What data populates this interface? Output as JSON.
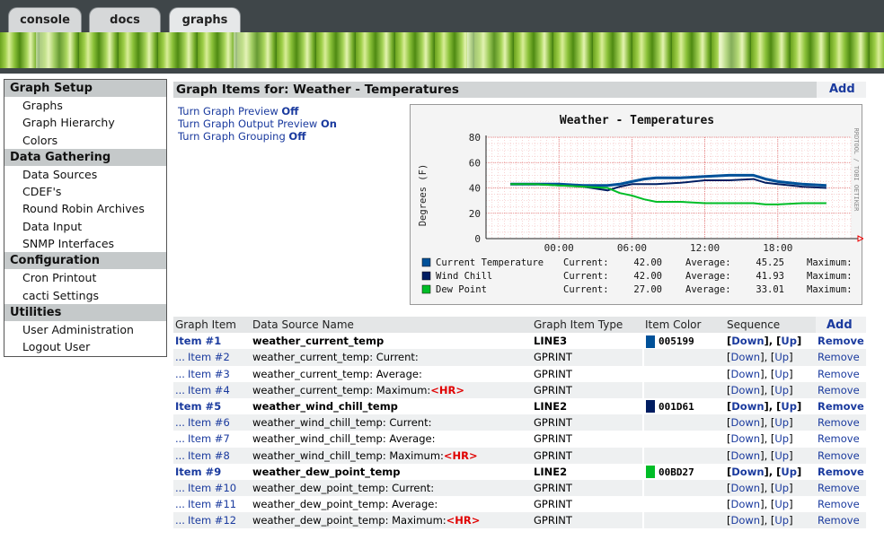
{
  "tabs": [
    "console",
    "docs",
    "graphs"
  ],
  "menu": {
    "sections": [
      {
        "title": "Graph Setup",
        "items": [
          "Graphs",
          "Graph Hierarchy",
          "Colors"
        ]
      },
      {
        "title": "Data Gathering",
        "items": [
          "Data Sources",
          "CDEF's",
          "Round Robin Archives",
          "Data Input",
          "SNMP Interfaces"
        ]
      },
      {
        "title": "Configuration",
        "items": [
          "Cron Printout",
          "cacti Settings"
        ]
      },
      {
        "title": "Utilities",
        "items": [
          "User Administration",
          "Logout User"
        ]
      }
    ]
  },
  "main": {
    "title": "Graph Items for: Weather - Temperatures",
    "add_label": "Add",
    "toggles": [
      {
        "label": "Turn Graph Preview",
        "state": "Off"
      },
      {
        "label": "Turn Graph Output Preview",
        "state": "On"
      },
      {
        "label": "Turn Graph Grouping",
        "state": "Off"
      }
    ]
  },
  "graph": {
    "side_text": "RRDTOOL / TOBI OETIKER",
    "legend": [
      {
        "name": "Current Temperature",
        "color": "#005199",
        "current": "42.00",
        "average": "45.25"
      },
      {
        "name": "Wind Chill",
        "color": "#001D61",
        "current": "42.00",
        "average": "41.93"
      },
      {
        "name": "Dew Point",
        "color": "#00BD27",
        "current": "27.00",
        "average": "33.01"
      }
    ],
    "legend_labels": {
      "current": "Current:",
      "average": "Average:",
      "maximum": "Maximum:"
    }
  },
  "chart_data": {
    "type": "line",
    "title": "Weather - Temperatures",
    "ylabel": "Degrees (F)",
    "ylim": [
      0,
      80
    ],
    "yticks": [
      0,
      20,
      40,
      60,
      80
    ],
    "xticks": [
      "00:00",
      "06:00",
      "12:00",
      "18:00"
    ],
    "x": [
      -4,
      -2,
      0,
      2,
      4,
      5,
      6,
      7,
      8,
      10,
      12,
      14,
      16,
      17,
      18,
      20,
      22
    ],
    "series": [
      {
        "name": "Current Temperature",
        "values": [
          43,
          43,
          43,
          42,
          42,
          43,
          45,
          47,
          48,
          48,
          49,
          50,
          50,
          47,
          45,
          43,
          42
        ]
      },
      {
        "name": "Wind Chill",
        "values": [
          43,
          43,
          42,
          41,
          38,
          41,
          43,
          43,
          43,
          44,
          46,
          46,
          47,
          44,
          43,
          41,
          40
        ]
      },
      {
        "name": "Dew Point",
        "values": [
          43,
          43,
          42,
          41,
          40,
          36,
          34,
          31,
          29,
          29,
          28,
          28,
          28,
          27,
          27,
          28,
          28
        ]
      }
    ]
  },
  "table": {
    "headers": [
      "Graph Item",
      "Data Source Name",
      "Graph Item Type",
      "Item Color",
      "Sequence"
    ],
    "add_label": "Add",
    "rows": [
      {
        "item": "Item #1",
        "source": "weather_current_temp",
        "hr": "",
        "type": "LINE3",
        "color": "005199",
        "primary": true
      },
      {
        "item": "Item #2",
        "source": "weather_current_temp: Current:",
        "hr": "",
        "type": "GPRINT",
        "color": "",
        "primary": false
      },
      {
        "item": "Item #3",
        "source": "weather_current_temp: Average:",
        "hr": "",
        "type": "GPRINT",
        "color": "",
        "primary": false
      },
      {
        "item": "Item #4",
        "source": "weather_current_temp: Maximum:",
        "hr": "<HR>",
        "type": "GPRINT",
        "color": "",
        "primary": false
      },
      {
        "item": "Item #5",
        "source": "weather_wind_chill_temp",
        "hr": "",
        "type": "LINE2",
        "color": "001D61",
        "primary": true
      },
      {
        "item": "Item #6",
        "source": "weather_wind_chill_temp: Current:",
        "hr": "",
        "type": "GPRINT",
        "color": "",
        "primary": false
      },
      {
        "item": "Item #7",
        "source": "weather_wind_chill_temp: Average:",
        "hr": "",
        "type": "GPRINT",
        "color": "",
        "primary": false
      },
      {
        "item": "Item #8",
        "source": "weather_wind_chill_temp: Maximum:",
        "hr": "<HR>",
        "type": "GPRINT",
        "color": "",
        "primary": false
      },
      {
        "item": "Item #9",
        "source": "weather_dew_point_temp",
        "hr": "",
        "type": "LINE2",
        "color": "00BD27",
        "primary": true
      },
      {
        "item": "Item #10",
        "source": "weather_dew_point_temp: Current:",
        "hr": "",
        "type": "GPRINT",
        "color": "",
        "primary": false
      },
      {
        "item": "Item #11",
        "source": "weather_dew_point_temp: Average:",
        "hr": "",
        "type": "GPRINT",
        "color": "",
        "primary": false
      },
      {
        "item": "Item #12",
        "source": "weather_dew_point_temp: Maximum:",
        "hr": "<HR>",
        "type": "GPRINT",
        "color": "",
        "primary": false
      }
    ],
    "seq_down": "Down",
    "seq_up": "Up",
    "remove_label": "Remove",
    "prefix": "..."
  }
}
